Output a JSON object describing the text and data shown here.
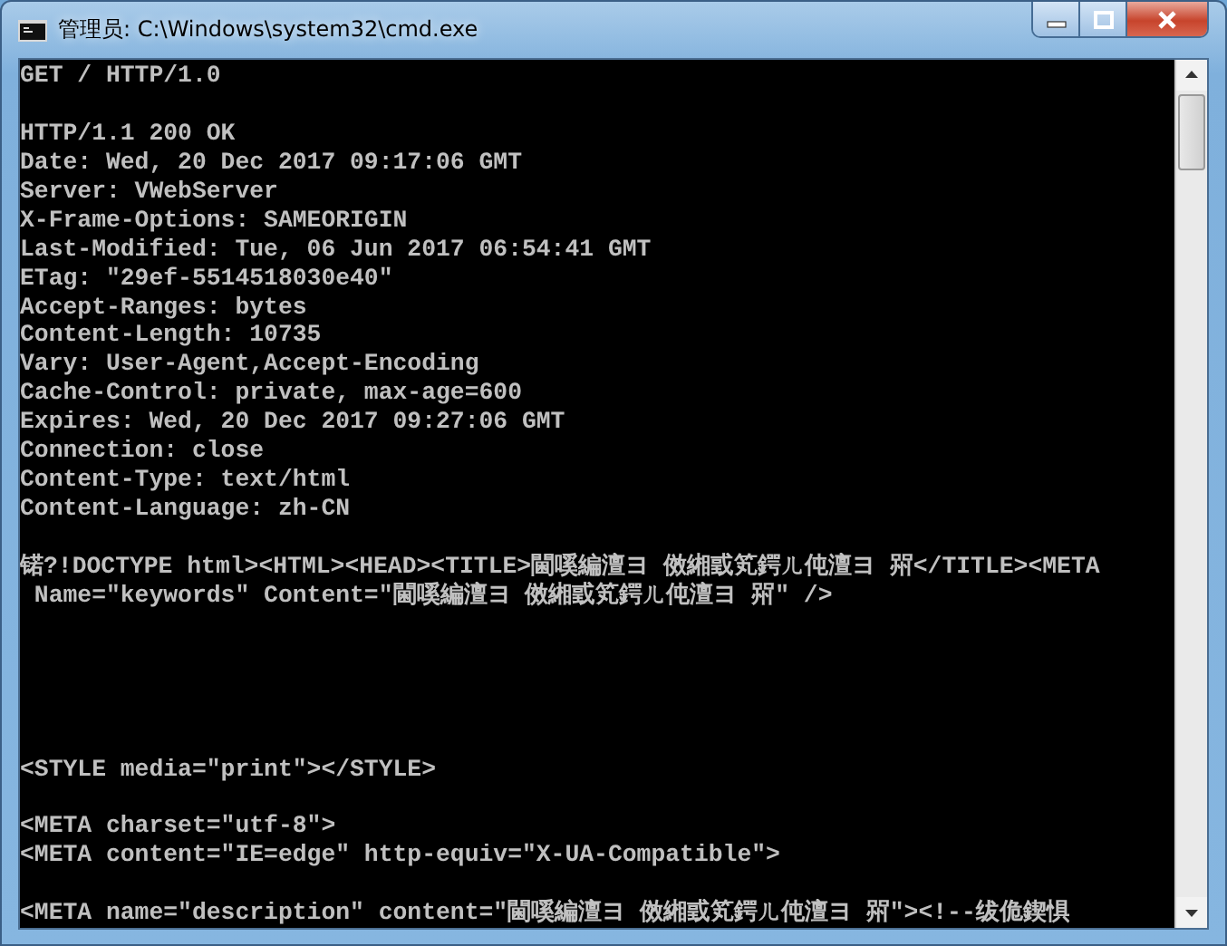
{
  "window": {
    "title": "管理员: C:\\Windows\\system32\\cmd.exe"
  },
  "console": {
    "lines": [
      {
        "kind": "text",
        "text": "GET / HTTP/1.0"
      },
      {
        "kind": "blank"
      },
      {
        "kind": "text",
        "text": "HTTP/1.1 200 OK"
      },
      {
        "kind": "text",
        "text": "Date: Wed, 20 Dec 2017 09:17:06 GMT"
      },
      {
        "kind": "text",
        "text": "Server: VWebServer"
      },
      {
        "kind": "text",
        "text": "X-Frame-Options: SAMEORIGIN"
      },
      {
        "kind": "text",
        "text": "Last-Modified: Tue, 06 Jun 2017 06:54:41 GMT"
      },
      {
        "kind": "text",
        "text": "ETag: \"29ef-5514518030e40\""
      },
      {
        "kind": "text",
        "text": "Accept-Ranges: bytes"
      },
      {
        "kind": "text",
        "text": "Content-Length: 10735"
      },
      {
        "kind": "text",
        "text": "Vary: User-Agent,Accept-Encoding"
      },
      {
        "kind": "text",
        "text": "Cache-Control: private, max-age=600"
      },
      {
        "kind": "text",
        "text": "Expires: Wed, 20 Dec 2017 09:27:06 GMT"
      },
      {
        "kind": "text",
        "text": "Connection: close"
      },
      {
        "kind": "text",
        "text": "Content-Type: text/html"
      },
      {
        "kind": "text",
        "text": "Content-Language: zh-CN"
      },
      {
        "kind": "blank"
      },
      {
        "kind": "text",
        "text": "锘?!DOCTYPE html><HTML><HEAD><TITLE>閫嗘編澶ヨ 傚緗戜笂鍔ㄦ伅澶ヨ 喌</TITLE><META"
      },
      {
        "kind": "text",
        "text": " Name=\"keywords\" Content=\"閫嗘編澶ヨ 傚緗戜笂鍔ㄦ伅澶ヨ 喌\" />"
      },
      {
        "kind": "blank"
      },
      {
        "kind": "blank"
      },
      {
        "kind": "blank"
      },
      {
        "kind": "blank"
      },
      {
        "kind": "blank"
      },
      {
        "kind": "text",
        "text": "<STYLE media=\"print\"></STYLE>"
      },
      {
        "kind": "blank"
      },
      {
        "kind": "text",
        "text": "<META charset=\"utf-8\">"
      },
      {
        "kind": "text",
        "text": "<META content=\"IE=edge\" http-equiv=\"X-UA-Compatible\">"
      },
      {
        "kind": "blank"
      },
      {
        "kind": "text",
        "text": "<META name=\"description\" content=\"閫嗘編澶ヨ 傚緗戜笂鍔ㄦ伅澶ヨ 喌\"><!--绂佹鍥惧"
      }
    ]
  }
}
